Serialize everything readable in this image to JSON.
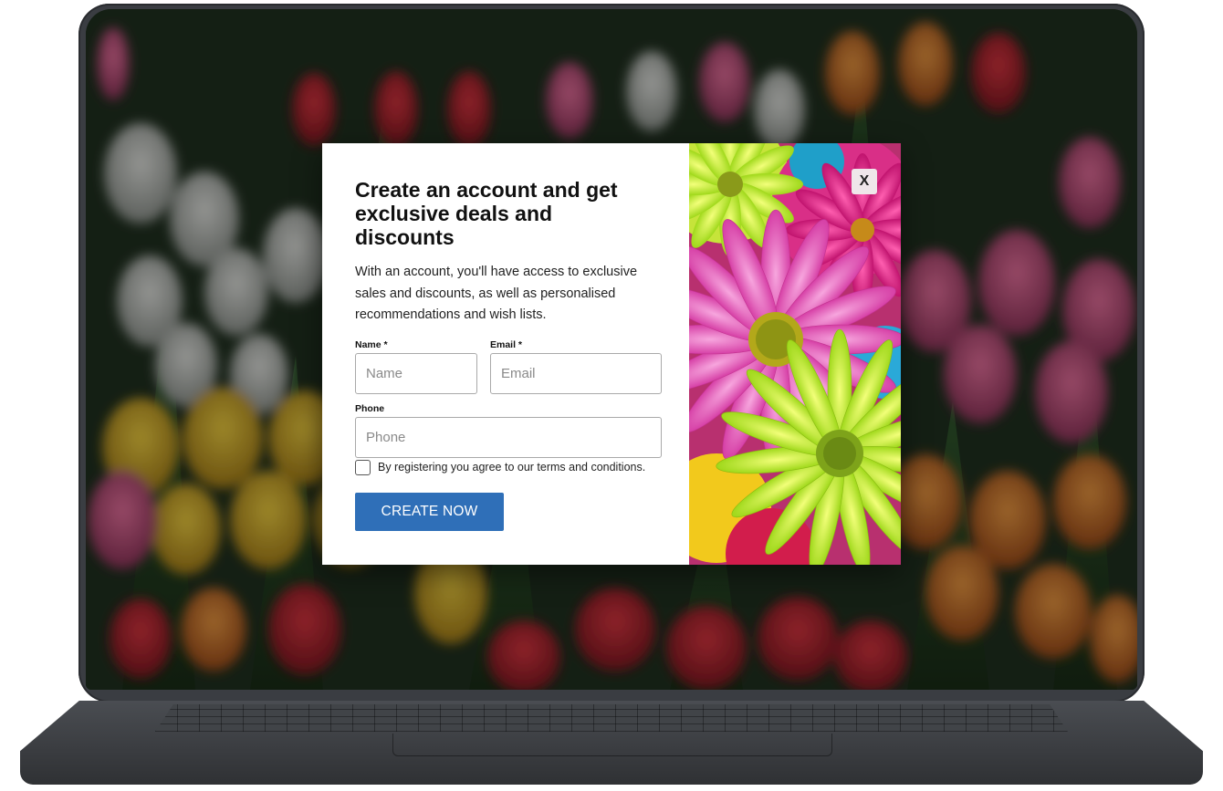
{
  "modal": {
    "title": "Create an account and get exclusive deals and discounts",
    "description": "With an account, you'll have access to exclusive sales and discounts, as well as personalised recommendations and wish lists.",
    "fields": {
      "name": {
        "label": "Name *",
        "placeholder": "Name",
        "value": ""
      },
      "email": {
        "label": "Email *",
        "placeholder": "Email",
        "value": ""
      },
      "phone": {
        "label": "Phone",
        "placeholder": "Phone",
        "value": ""
      }
    },
    "terms_text": "By registering you agree to our terms and conditions.",
    "terms_checked": false,
    "cta_label": "CREATE NOW",
    "close_label": "X",
    "image_subject": "flower-photo",
    "colors": {
      "cta": "#2f6fb8",
      "modal_bg": "#ffffff"
    }
  },
  "background": {
    "subject": "tulip-field-photo"
  }
}
